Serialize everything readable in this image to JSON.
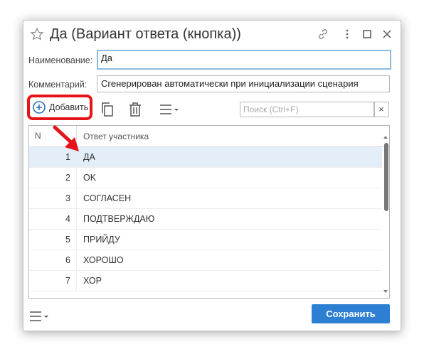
{
  "window": {
    "title": "Да (Вариант ответа (кнопка))"
  },
  "form": {
    "name_label": "Наименование:",
    "name_value": "Да",
    "comment_label": "Комментарий:",
    "comment_value": "Сгенерирован автоматически при инициализации сценария"
  },
  "toolbar": {
    "add_label": "Добавить",
    "search_placeholder": "Поиск (Ctrl+F)",
    "search_clear": "×"
  },
  "table": {
    "columns": [
      "N",
      "Ответ участника"
    ],
    "rows": [
      {
        "n": "1",
        "answer": "ДА"
      },
      {
        "n": "2",
        "answer": "OK"
      },
      {
        "n": "3",
        "answer": "СОГЛАСЕН"
      },
      {
        "n": "4",
        "answer": "ПОДТВЕРЖДАЮ"
      },
      {
        "n": "5",
        "answer": "ПРИЙДУ"
      },
      {
        "n": "6",
        "answer": "ХОРОШО"
      },
      {
        "n": "7",
        "answer": "ХОР"
      }
    ],
    "selected_index": 0
  },
  "footer": {
    "save_label": "Сохранить"
  },
  "icons": {
    "favorite": "star-icon",
    "link": "link-icon",
    "more": "more-vertical-icon",
    "maximize": "maximize-icon",
    "close": "close-icon",
    "add": "plus-circle-icon",
    "copy": "copy-icon",
    "delete": "trash-icon",
    "menu": "menu-icon"
  },
  "colors": {
    "accent": "#2c7fd2",
    "highlight": "#e5131a",
    "selected_row": "#e3eef8"
  }
}
